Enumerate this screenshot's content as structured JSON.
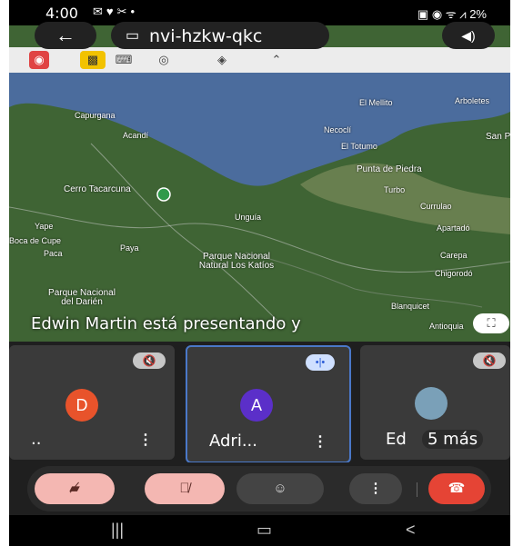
{
  "status_bar": {
    "time": "4:00",
    "battery": "2%"
  },
  "header": {
    "meeting_code": "nvi-hzkw-qkc"
  },
  "map": {
    "labels": [
      "El Mellito",
      "Arboletes",
      "Capurgana",
      "Necoclí",
      "San P de U",
      "Acandí",
      "El Totumo",
      "Punta de Piedra",
      "Turbo",
      "Cerro Tacarcuna",
      "Currulao",
      "Yape",
      "Unguía",
      "Apartadó",
      "Boca de Cupe",
      "Paya",
      "Carepa",
      "Paca",
      "Parque Nacional Natural Los Katíos",
      "Chigorodó",
      "Parque Nacional del Darién",
      "Blanquicet",
      "Antioquia"
    ]
  },
  "presentation": {
    "banner": "Edwin Martin está presentando y"
  },
  "tiles": [
    {
      "initial": "D",
      "name": "..",
      "avatar_color": "#e8532b"
    },
    {
      "initial": "A",
      "name": "Adri...",
      "avatar_color": "#5b2fc9"
    },
    {
      "initial": "",
      "name": "Ed",
      "more": "5 más"
    }
  ],
  "controls": {
    "hang_label": "end call"
  }
}
